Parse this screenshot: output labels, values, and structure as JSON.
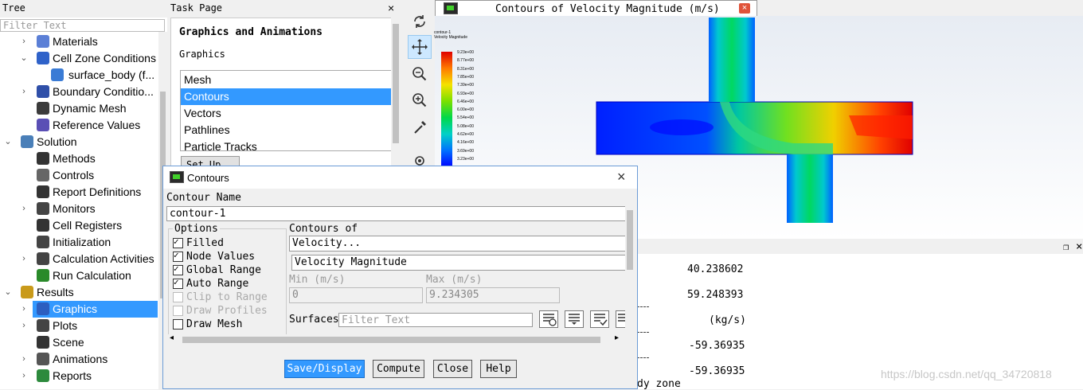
{
  "tree": {
    "title": "Tree",
    "filter_placeholder": "Filter Text",
    "items": [
      {
        "label": "Materials",
        "icon": "materials-icon",
        "expand": "›"
      },
      {
        "label": "Cell Zone Conditions",
        "icon": "cell-zone-icon",
        "expand": "⌄"
      },
      {
        "label": "surface_body (f...",
        "icon": "surface-body-icon",
        "expand": ""
      },
      {
        "label": "Boundary Conditio...",
        "icon": "boundary-icon",
        "expand": "›"
      },
      {
        "label": "Dynamic Mesh",
        "icon": "dynamic-mesh-icon",
        "expand": ""
      },
      {
        "label": "Reference Values",
        "icon": "reference-values-icon",
        "expand": ""
      },
      {
        "label": "Solution",
        "icon": "solution-icon",
        "expand": "⌄"
      },
      {
        "label": "Methods",
        "icon": "methods-icon",
        "expand": ""
      },
      {
        "label": "Controls",
        "icon": "controls-icon",
        "expand": ""
      },
      {
        "label": "Report Definitions",
        "icon": "report-definitions-icon",
        "expand": ""
      },
      {
        "label": "Monitors",
        "icon": "monitors-icon",
        "expand": "›"
      },
      {
        "label": "Cell Registers",
        "icon": "cell-registers-icon",
        "expand": ""
      },
      {
        "label": "Initialization",
        "icon": "initialization-icon",
        "expand": ""
      },
      {
        "label": "Calculation Activities",
        "icon": "calc-activities-icon",
        "expand": "›"
      },
      {
        "label": "Run Calculation",
        "icon": "run-calculation-icon",
        "expand": ""
      },
      {
        "label": "Results",
        "icon": "results-icon",
        "expand": "⌄"
      },
      {
        "label": "Graphics",
        "icon": "graphics-icon",
        "expand": "›"
      },
      {
        "label": "Plots",
        "icon": "plots-icon",
        "expand": "›"
      },
      {
        "label": "Scene",
        "icon": "scene-icon",
        "expand": ""
      },
      {
        "label": "Animations",
        "icon": "animations-icon",
        "expand": "›"
      },
      {
        "label": "Reports",
        "icon": "reports-icon",
        "expand": "›"
      }
    ]
  },
  "task_page": {
    "title": "Task Page",
    "close": "×",
    "heading": "Graphics and Animations",
    "section": "Graphics",
    "list": [
      "Mesh",
      "Contours",
      "Vectors",
      "Pathlines",
      "Particle Tracks"
    ],
    "selected": "Contours",
    "setup_button": "Set Up..."
  },
  "toolbar": {
    "buttons": [
      "rotate-icon",
      "pan-icon",
      "zoom-fit-icon",
      "zoom-in-icon",
      "probe-icon",
      "select-icon"
    ]
  },
  "graphics_window": {
    "tab_title": "Contours of Velocity Magnitude (m/s)",
    "tab_close": "×",
    "legend_title_line1": "contour-1",
    "legend_title_line2": "Velocity Magnitude",
    "legend_values": [
      "9.23e+00",
      "8.77e+00",
      "8.31e+00",
      "7.85e+00",
      "7.39e+00",
      "6.93e+00",
      "6.46e+00",
      "6.00e+00",
      "5.54e+00",
      "5.08e+00",
      "4.62e+00",
      "4.16e+00",
      "3.69e+00",
      "3.23e+00"
    ]
  },
  "console": {
    "lines": [
      {
        "text": "40.238602"
      },
      {
        "text": "59.248393"
      },
      {
        "text": "(kg/s)"
      },
      {
        "text": "-59.36935"
      },
      {
        "text": "-59.36935"
      },
      {
        "text": "dy zone"
      }
    ],
    "restore_icon": "❐",
    "close_icon": "×",
    "watermark": "https://blog.csdn.net/qq_34720818"
  },
  "dialog": {
    "title": "Contours",
    "close": "×",
    "contour_name_label": "Contour Name",
    "contour_name": "contour-1",
    "options_label": "Options",
    "options": [
      {
        "label": "Filled",
        "checked": true,
        "enabled": true
      },
      {
        "label": "Node Values",
        "checked": true,
        "enabled": true
      },
      {
        "label": "Global Range",
        "checked": true,
        "enabled": true
      },
      {
        "label": "Auto Range",
        "checked": true,
        "enabled": true
      },
      {
        "label": "Clip to Range",
        "checked": false,
        "enabled": false
      },
      {
        "label": "Draw Profiles",
        "checked": false,
        "enabled": false
      },
      {
        "label": "Draw Mesh",
        "checked": false,
        "enabled": true
      }
    ],
    "contours_of_label": "Contours of",
    "contours_of_category": "Velocity...",
    "contours_of_quantity": "Velocity Magnitude",
    "min_label": "Min (m/s)",
    "max_label": "Max (m/s)",
    "min_value": "0",
    "max_value": "9.234305",
    "surfaces_label": "Surfaces",
    "surfaces_filter_placeholder": "Filter Text",
    "buttons": {
      "save_display": "Save/Display",
      "compute": "Compute",
      "close": "Close",
      "help": "Help"
    }
  }
}
